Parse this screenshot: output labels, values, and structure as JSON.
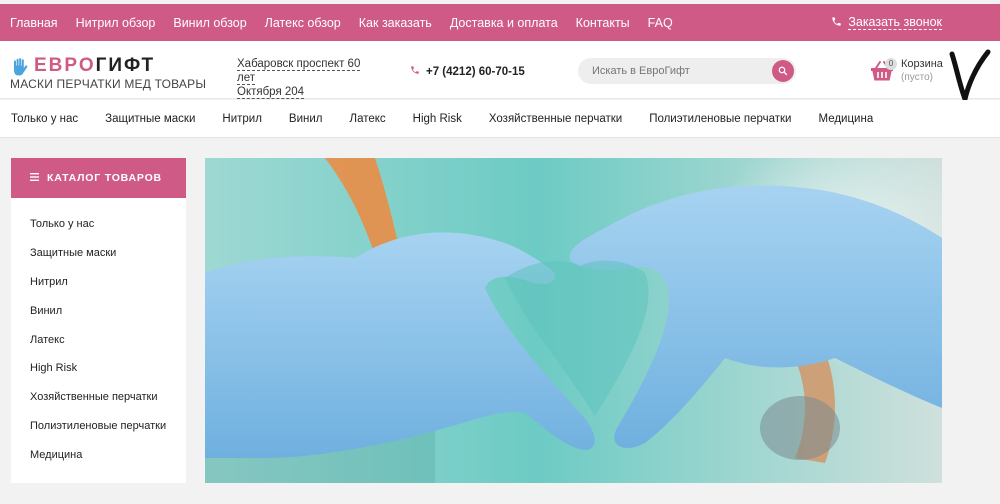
{
  "topbar": {
    "nav": [
      "Главная",
      "Нитрил обзор",
      "Винил обзор",
      "Латекс обзор",
      "Как заказать",
      "Доставка и оплата",
      "Контакты",
      "FAQ"
    ],
    "callback_label": "Заказать звонок"
  },
  "header": {
    "brand_part1": "ЕВРО",
    "brand_part2": "ГИФТ",
    "tagline": "МАСКИ ПЕРЧАТКИ МЕД ТОВАРЫ",
    "address_line1": "Хабаровск проспект 60 лет",
    "address_line2": "Октября 204",
    "phone": "+7 (4212) 60-70-15",
    "search_placeholder": "Искать в ЕвроГифт",
    "cart_count": "0",
    "cart_label": "Корзина",
    "cart_status": "(пусто)"
  },
  "categories": [
    "Только у нас",
    "Защитные маски",
    "Нитрил",
    "Винил",
    "Латекс",
    "High Risk",
    "Хозяйственные перчатки",
    "Полиэтиленовые перчатки",
    "Медицина"
  ],
  "sidebar": {
    "title": "КАТАЛОГ ТОВАРОВ",
    "items": [
      "Только у нас",
      "Защитные маски",
      "Нитрил",
      "Винил",
      "Латекс",
      "High Risk",
      "Хозяйственные перчатки",
      "Полиэтиленовые перчатки",
      "Медицина"
    ]
  },
  "colors": {
    "accent": "#cf5a86",
    "glove": "#8ec3e8",
    "scrubs": "#5fc3bd"
  },
  "icons": {
    "logo": "hand-icon",
    "callback": "phone-icon",
    "phone": "phone-icon",
    "search": "search-icon",
    "cart": "basket-icon",
    "catalog": "burger-icon"
  }
}
